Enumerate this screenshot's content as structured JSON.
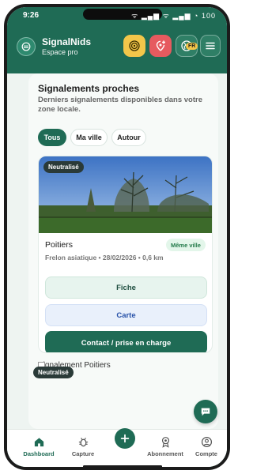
{
  "status": {
    "time": "9:26",
    "icons": "ᯤ ▂▄▆ ᯤ ▂▄▆ ◔ 100"
  },
  "header": {
    "title": "SignalNids",
    "subtitle": "Espace pro",
    "lang_badge": "FR",
    "icons": [
      "logo-icon",
      "radar-icon",
      "add-location-icon",
      "globe-icon",
      "menu-icon"
    ]
  },
  "section": {
    "title": "Signalements proches",
    "subtitle": "Derniers signalements disponibles dans votre zone locale."
  },
  "filters": {
    "all": "Tous",
    "my_city": "Ma ville",
    "other": "Autour"
  },
  "report": {
    "status": "Neutralisé",
    "city": "Poitiers",
    "same_city": "Même ville",
    "meta": "Frelon asiatique • 28/02/2026 • 0,6 km",
    "actions": {
      "fiche": "Fiche",
      "carte": "Carte",
      "contact": "Contact / prise en charge"
    }
  },
  "report2": {
    "alt_text": "Signalement Poitiers",
    "status": "Neutralisé"
  },
  "bottom_nav": {
    "dashboard": "Dashboard",
    "capture": "Capture",
    "subscription": "Abonnement",
    "account": "Compte"
  },
  "colors": {
    "primary": "#1f6b55",
    "radar": "#f3c64a",
    "alert": "#e65a5f"
  }
}
